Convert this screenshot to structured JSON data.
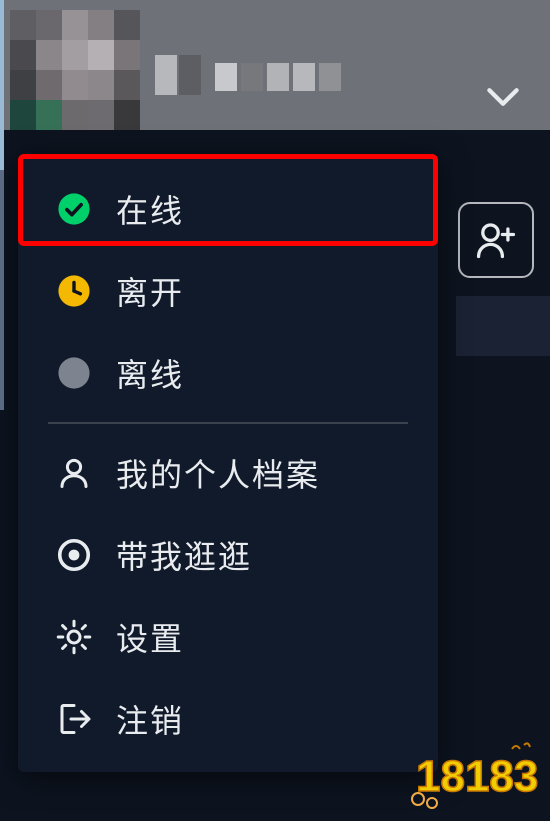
{
  "menu": {
    "status": {
      "online": "在线",
      "away": "离开",
      "offline": "离线"
    },
    "actions": {
      "profile": "我的个人档案",
      "explore": "带我逛逛",
      "settings": "设置",
      "logout": "注销"
    }
  },
  "colors": {
    "online_green": "#00d06a",
    "away_yellow": "#f5b800",
    "offline_gray": "#7d8490",
    "highlight": "#ff0000",
    "menu_bg": "#111a2b"
  },
  "watermark": "18183"
}
